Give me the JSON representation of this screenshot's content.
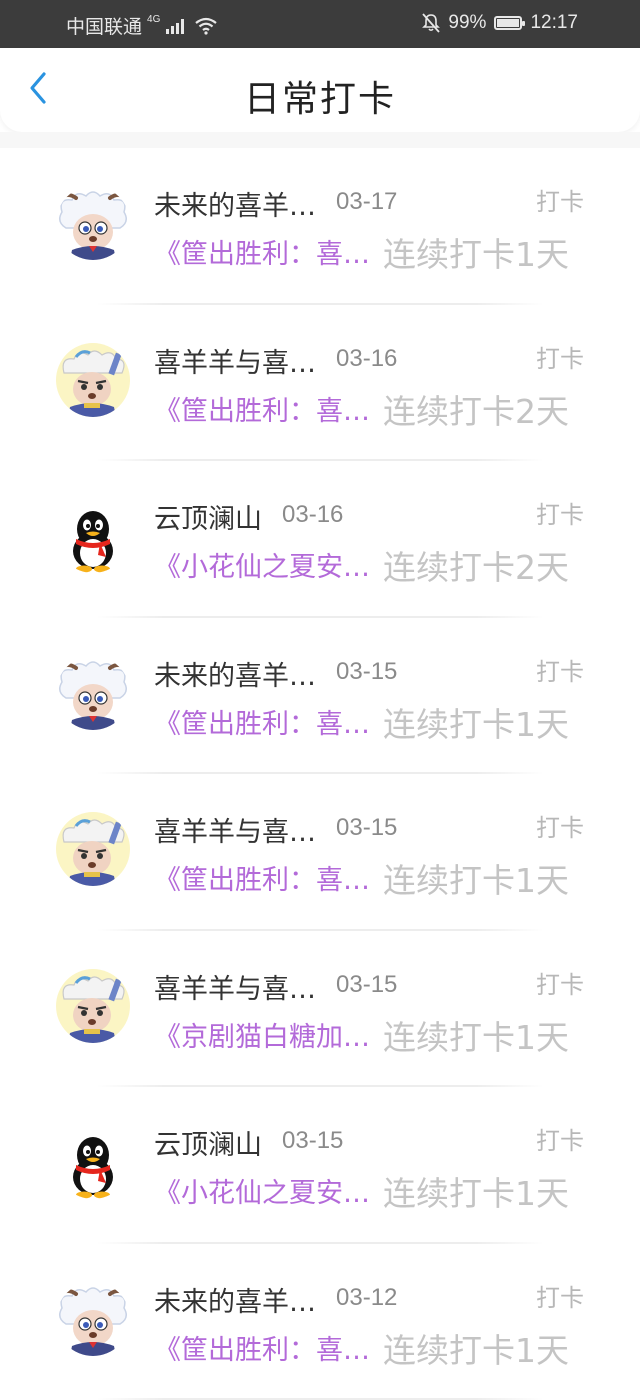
{
  "status_bar": {
    "carrier": "中国联通",
    "network": "4G",
    "battery": "99%",
    "time": "12:17"
  },
  "header": {
    "title": "日常打卡"
  },
  "records": [
    {
      "avatar": "sheep-white",
      "name": "未来的喜羊…",
      "date": "03-17",
      "tag": "打卡",
      "book": "《筐出胜利：喜…",
      "streak": "连续打卡1天"
    },
    {
      "avatar": "sheep-gold",
      "name": "喜羊羊与喜…",
      "date": "03-16",
      "tag": "打卡",
      "book": "《筐出胜利：喜…",
      "streak": "连续打卡2天"
    },
    {
      "avatar": "penguin",
      "name": "云顶澜山",
      "date": "03-16",
      "tag": "打卡",
      "book": "《小花仙之夏安…",
      "streak": "连续打卡2天"
    },
    {
      "avatar": "sheep-white",
      "name": "未来的喜羊…",
      "date": "03-15",
      "tag": "打卡",
      "book": "《筐出胜利：喜…",
      "streak": "连续打卡1天"
    },
    {
      "avatar": "sheep-gold",
      "name": "喜羊羊与喜…",
      "date": "03-15",
      "tag": "打卡",
      "book": "《筐出胜利：喜…",
      "streak": "连续打卡1天"
    },
    {
      "avatar": "sheep-gold",
      "name": "喜羊羊与喜…",
      "date": "03-15",
      "tag": "打卡",
      "book": "《京剧猫白糖加…",
      "streak": "连续打卡1天"
    },
    {
      "avatar": "penguin",
      "name": "云顶澜山",
      "date": "03-15",
      "tag": "打卡",
      "book": "《小花仙之夏安…",
      "streak": "连续打卡1天"
    },
    {
      "avatar": "sheep-white",
      "name": "未来的喜羊…",
      "date": "03-12",
      "tag": "打卡",
      "book": "《筐出胜利：喜…",
      "streak": "连续打卡1天"
    }
  ]
}
